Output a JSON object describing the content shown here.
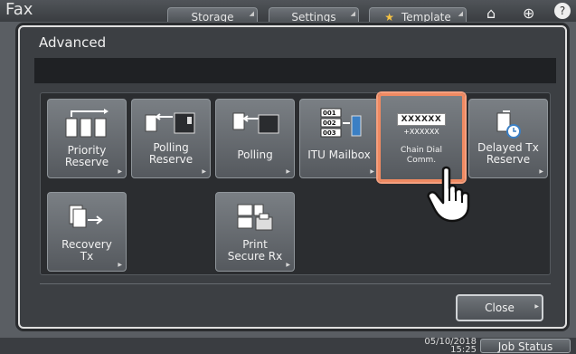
{
  "background": {
    "app_title": "Fax",
    "tabs": [
      {
        "label": "Storage"
      },
      {
        "label": "Settings"
      },
      {
        "label": "Template"
      }
    ],
    "date": "05/10/2018",
    "time": "15:25",
    "job_status_label": "Job Status"
  },
  "modal": {
    "title": "Advanced",
    "tiles": [
      {
        "label": "Priority Reserve",
        "icon": "priority-reserve-icon"
      },
      {
        "label": "Polling Reserve",
        "icon": "polling-reserve-icon"
      },
      {
        "label": "Polling",
        "icon": "polling-icon"
      },
      {
        "label": "ITU Mailbox",
        "icon": "itu-mailbox-icon"
      },
      {
        "label": "Chain Dial Comm.",
        "icon": "chain-dial-icon",
        "icon_text": "XXXXXX",
        "icon_subtext": "+XXXXXX"
      },
      {
        "label": "Delayed Tx Reserve",
        "icon": "delayed-tx-icon"
      },
      {
        "label": "Recovery Tx",
        "icon": "recovery-tx-icon"
      },
      {
        "label": "Print Secure Rx",
        "icon": "print-secure-rx-icon"
      }
    ],
    "close_label": "Close"
  },
  "colors": {
    "selection_border": "#f08a62",
    "tile_bg": "#6a6f74",
    "modal_bg": "#3c3f43"
  }
}
